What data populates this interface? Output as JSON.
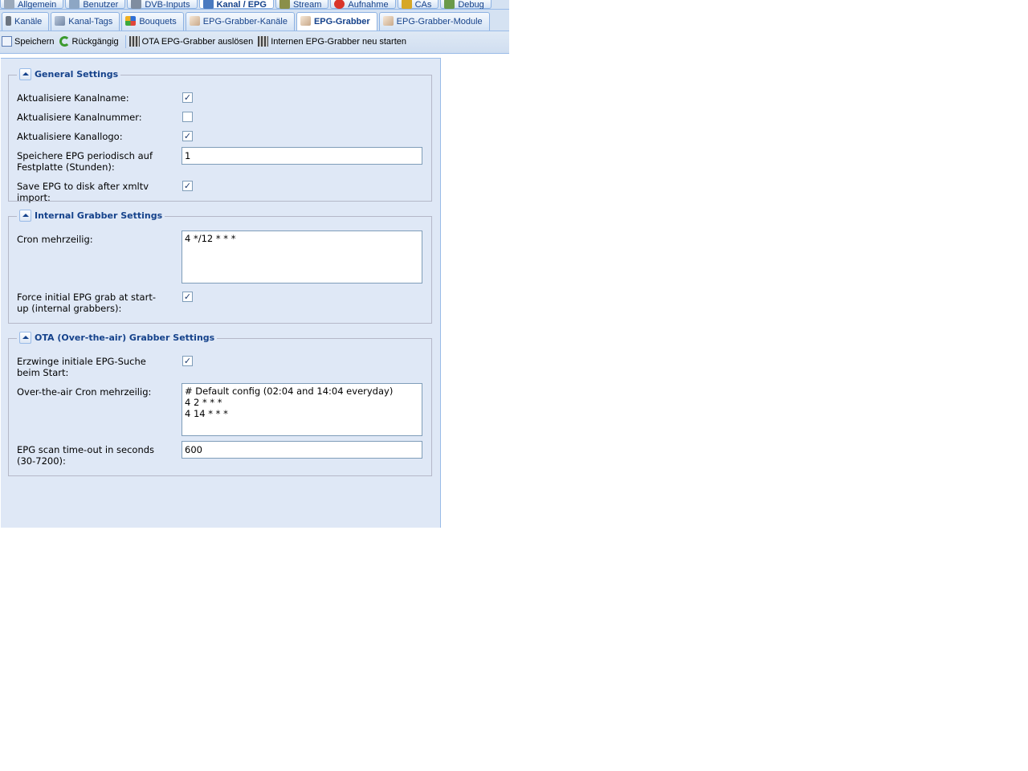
{
  "top_tabs": [
    {
      "label": "Allgemein",
      "icon": "wrench-icon"
    },
    {
      "label": "Benutzer",
      "icon": "users-icon"
    },
    {
      "label": "DVB-Inputs",
      "icon": "dvb-input-icon"
    },
    {
      "label": "Kanal / EPG",
      "icon": "tv-icon",
      "active": true
    },
    {
      "label": "Stream",
      "icon": "stream-icon"
    },
    {
      "label": "Aufnahme",
      "icon": "record-icon"
    },
    {
      "label": "CAs",
      "icon": "key-icon"
    },
    {
      "label": "Debug",
      "icon": "bug-icon"
    }
  ],
  "sub_tabs": [
    {
      "label": "Kanäle",
      "icon": "remote-icon"
    },
    {
      "label": "Kanal-Tags",
      "icon": "tag-icon"
    },
    {
      "label": "Bouquets",
      "icon": "grid-icon"
    },
    {
      "label": "EPG-Grabber-Kanäle",
      "icon": "grabber-icon"
    },
    {
      "label": "EPG-Grabber",
      "icon": "grabber-icon",
      "active": true
    },
    {
      "label": "EPG-Grabber-Module",
      "icon": "grabber-icon"
    }
  ],
  "toolbar": {
    "save": "Speichern",
    "undo": "Rückgängig",
    "trigger_ota": "OTA EPG-Grabber auslösen",
    "restart_internal": "Internen EPG-Grabber neu starten"
  },
  "general": {
    "legend": "General Settings",
    "update_name_label": "Aktualisiere Kanalname:",
    "update_name_checked": true,
    "update_number_label": "Aktualisiere Kanalnummer:",
    "update_number_checked": false,
    "update_logo_label": "Aktualisiere Kanallogo:",
    "update_logo_checked": true,
    "save_periodic_label": "Speichere EPG periodisch auf Festplatte (Stunden):",
    "save_periodic_value": "1",
    "save_xmltv_label": "Save EPG to disk after xmltv import:",
    "save_xmltv_checked": true
  },
  "internal": {
    "legend": "Internal Grabber Settings",
    "cron_label": "Cron mehrzeilig:",
    "cron_value": "4 */12 * * *",
    "force_label": "Force initial EPG grab at start-up (internal grabbers):",
    "force_checked": true
  },
  "ota": {
    "legend": "OTA (Over-the-air) Grabber Settings",
    "force_label": "Erzwinge initiale EPG-Suche beim Start:",
    "force_checked": true,
    "cron_label": "Over-the-air Cron mehrzeilig:",
    "cron_value": "# Default config (02:04 and 14:04 everyday)\n4 2 * * *\n4 14 * * *",
    "timeout_label": "EPG scan time-out in seconds (30-7200):",
    "timeout_value": "600"
  }
}
